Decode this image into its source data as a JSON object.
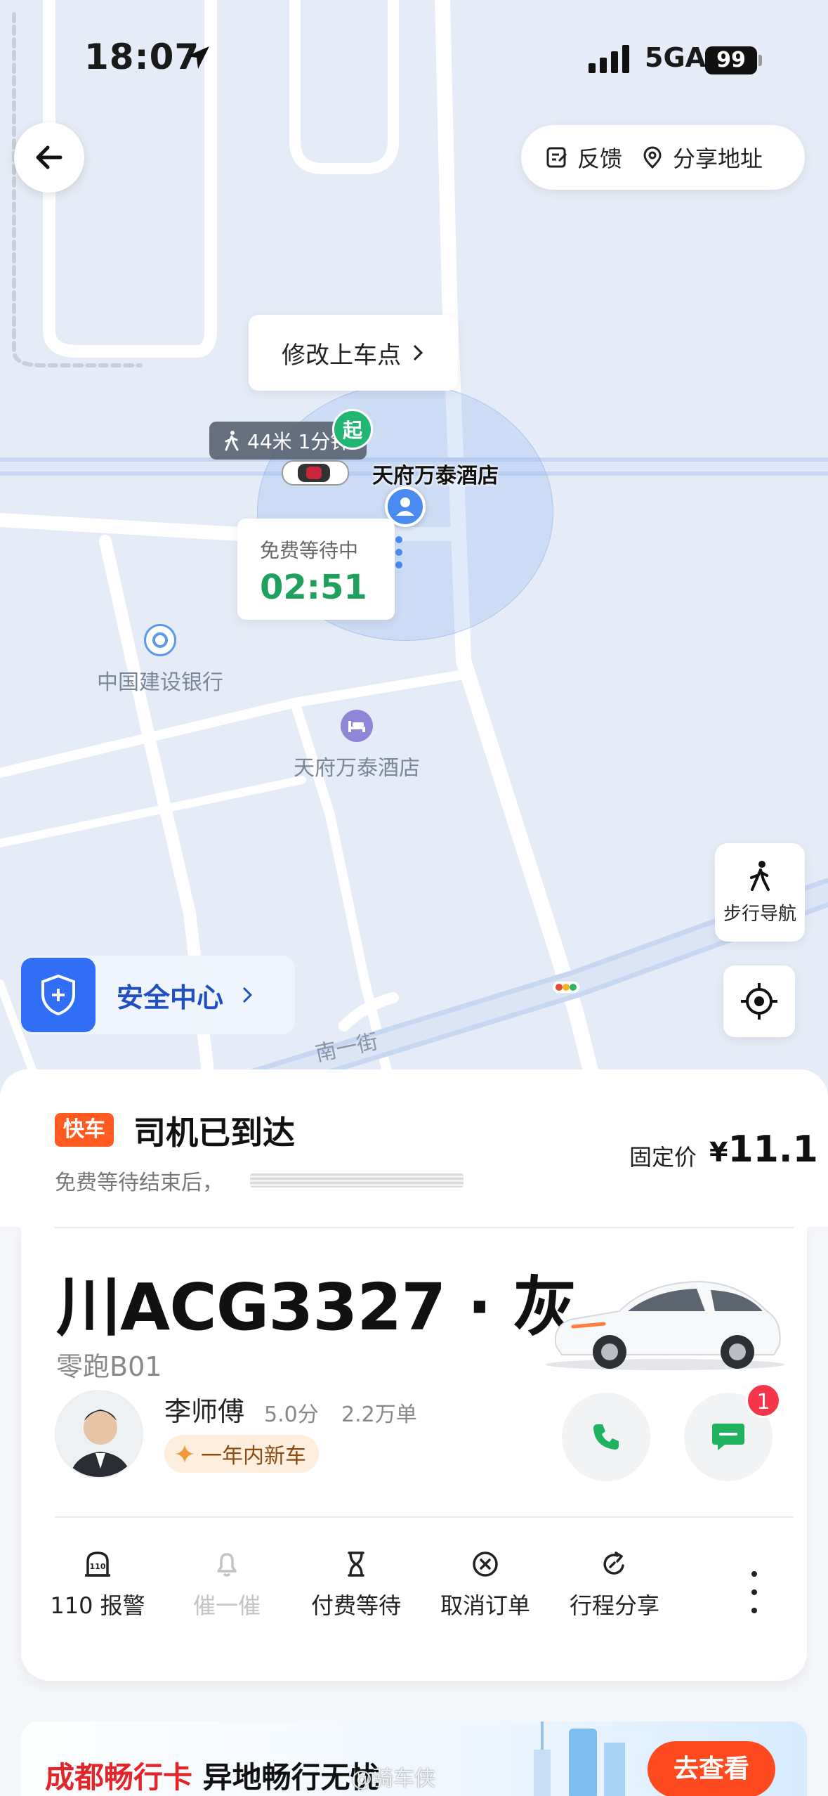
{
  "status_bar": {
    "time": "18:07",
    "network": "5GA",
    "battery": "99"
  },
  "map": {
    "top_actions": {
      "feedback": "反馈",
      "share_address": "分享地址"
    },
    "change_pickup": "修改上车点",
    "walk_tag": "44米 1分钟",
    "start_pin": "起",
    "pickup_name": "天府万泰酒店",
    "wait": {
      "label": "免费等待中",
      "timer": "02:51"
    },
    "pois": [
      {
        "name": "中国建设银行",
        "icon": "bank-icon",
        "color": "#5b9ae8"
      },
      {
        "name": "天府万泰酒店",
        "icon": "hotel-icon",
        "color": "#8f86d8"
      }
    ],
    "road_name": "南一街",
    "walk_nav": "步行导航",
    "safety_center": "安全中心"
  },
  "order": {
    "tag": "快车",
    "status": "司机已到达",
    "wait_note": "免费等待结束后，",
    "price_label": "固定价",
    "price_currency": "¥",
    "price_value": "11.1"
  },
  "vehicle": {
    "plate": "川ACG3327 · 灰",
    "model": "零跑B01"
  },
  "driver": {
    "name": "李师傅",
    "score": "5.0分",
    "orders": "2.2万单",
    "badge": "一年内新车",
    "unread": "1"
  },
  "actions": [
    {
      "label": "110 报警",
      "icon": "police-icon",
      "enabled": true
    },
    {
      "label": "催一催",
      "icon": "bell-icon",
      "enabled": false
    },
    {
      "label": "付费等待",
      "icon": "hourglass-icon",
      "enabled": true
    },
    {
      "label": "取消订单",
      "icon": "cancel-icon",
      "enabled": true
    },
    {
      "label": "行程分享",
      "icon": "share-icon",
      "enabled": true
    }
  ],
  "banner": {
    "title_red": "成都畅行卡",
    "title": " 异地畅行无忧",
    "button": "去查看"
  },
  "watermark": "@骑车侠",
  "colors": {
    "accent_green": "#1fa05e",
    "brand_orange": "#ff5a1f",
    "safety_blue": "#2f6ef5",
    "badge_red": "#f5364a"
  }
}
